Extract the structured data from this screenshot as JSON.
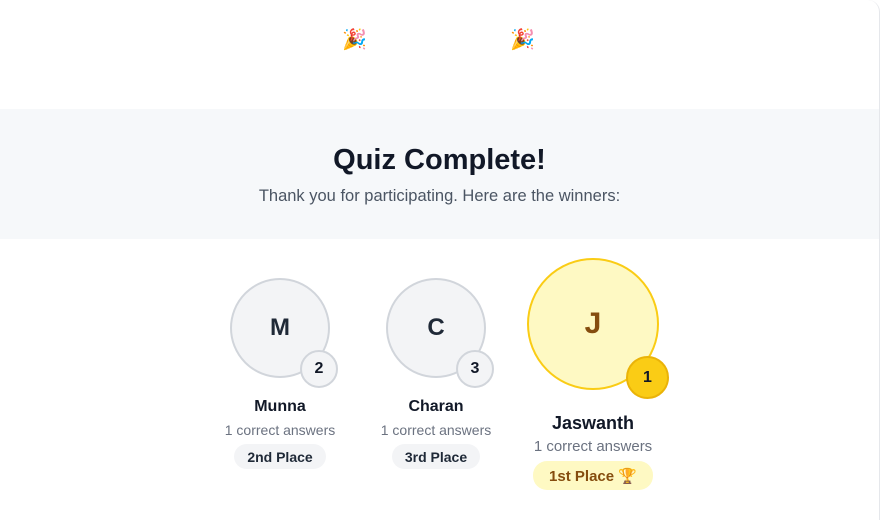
{
  "header": {
    "confetti_left": "🎉",
    "confetti_right": "🎉",
    "title": "Quiz Complete!",
    "subtitle": "Thank you for participating. Here are the winners:"
  },
  "winners": [
    {
      "initial": "M",
      "rank": "2",
      "name": "Munna",
      "score": "1 correct answers",
      "place": "2nd Place"
    },
    {
      "initial": "C",
      "rank": "3",
      "name": "Charan",
      "score": "1 correct answers",
      "place": "3rd Place"
    },
    {
      "initial": "J",
      "rank": "1",
      "name": "Jaswanth",
      "score": "1 correct answers",
      "place": "1st Place 🏆"
    }
  ],
  "colors": {
    "gold_fill": "#fef9c3",
    "gold_border": "#facc15",
    "silver_fill": "#f3f4f6",
    "banner_bg": "#f6f8fa"
  }
}
